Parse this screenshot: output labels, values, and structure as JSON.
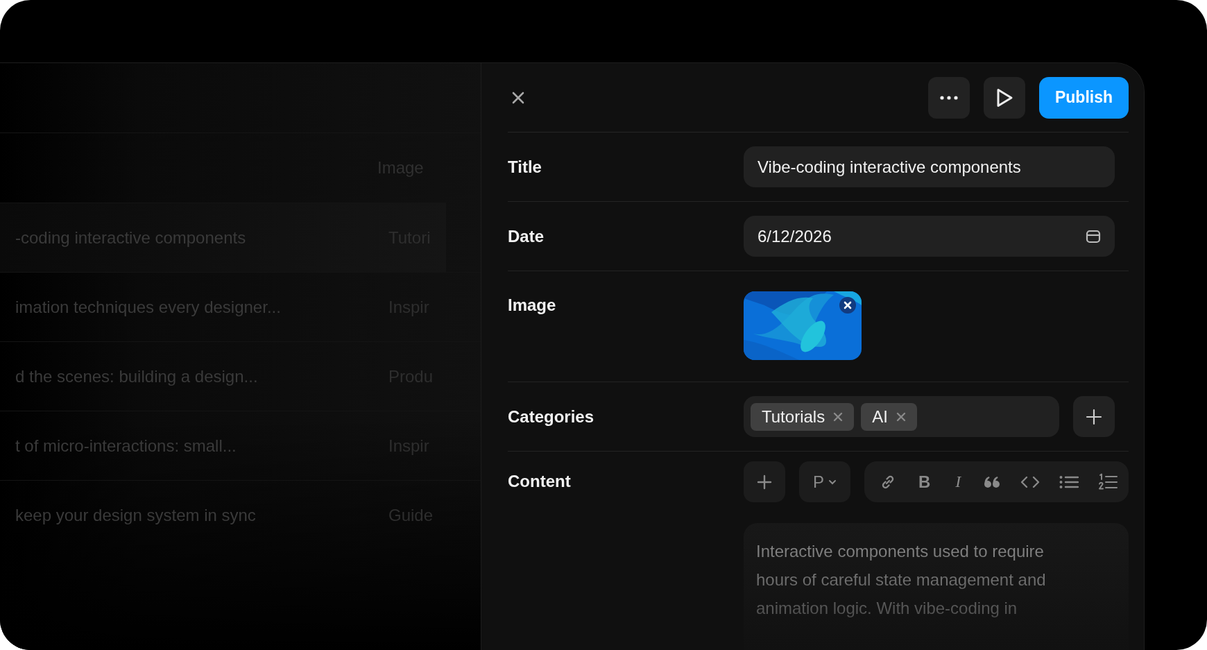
{
  "list": {
    "header": {
      "column_2": "Image"
    },
    "rows": [
      {
        "column_1": "-coding interactive components",
        "column_2": "Tutori",
        "selected": true
      },
      {
        "column_1": "imation techniques every designer...",
        "column_2": "Inspir",
        "selected": false
      },
      {
        "column_1": "d the scenes: building a design...",
        "column_2": "Produ",
        "selected": false
      },
      {
        "column_1": "t of micro-interactions: small...",
        "column_2": "Inspir",
        "selected": false
      },
      {
        "column_1": "keep your design system in sync",
        "column_2": "Guide",
        "selected": false
      }
    ]
  },
  "editor": {
    "publish": "Publish",
    "fields": [
      {
        "kind": "text",
        "label": "Title",
        "value": "Vibe-coding interactive components"
      },
      {
        "kind": "date",
        "label": "Date",
        "value": "6/12/2026"
      },
      {
        "label": "Image"
      },
      {
        "kind": "tags",
        "label": "Categories",
        "tags": [
          "Tutorials",
          "AI"
        ]
      },
      {
        "kind": "content",
        "label": "Content",
        "block_type": "P",
        "tools": [
          {
            "kind": "link"
          },
          {
            "kind": "bold",
            "label": "B"
          },
          {
            "kind": "italic",
            "label": "I"
          },
          {
            "kind": "quote"
          },
          {
            "kind": "code"
          },
          {
            "kind": "bullets"
          },
          {
            "kind": "numbered"
          }
        ],
        "text": "Interactive components used to require hours of careful state management and animation logic. With vibe-coding in"
      }
    ]
  }
}
